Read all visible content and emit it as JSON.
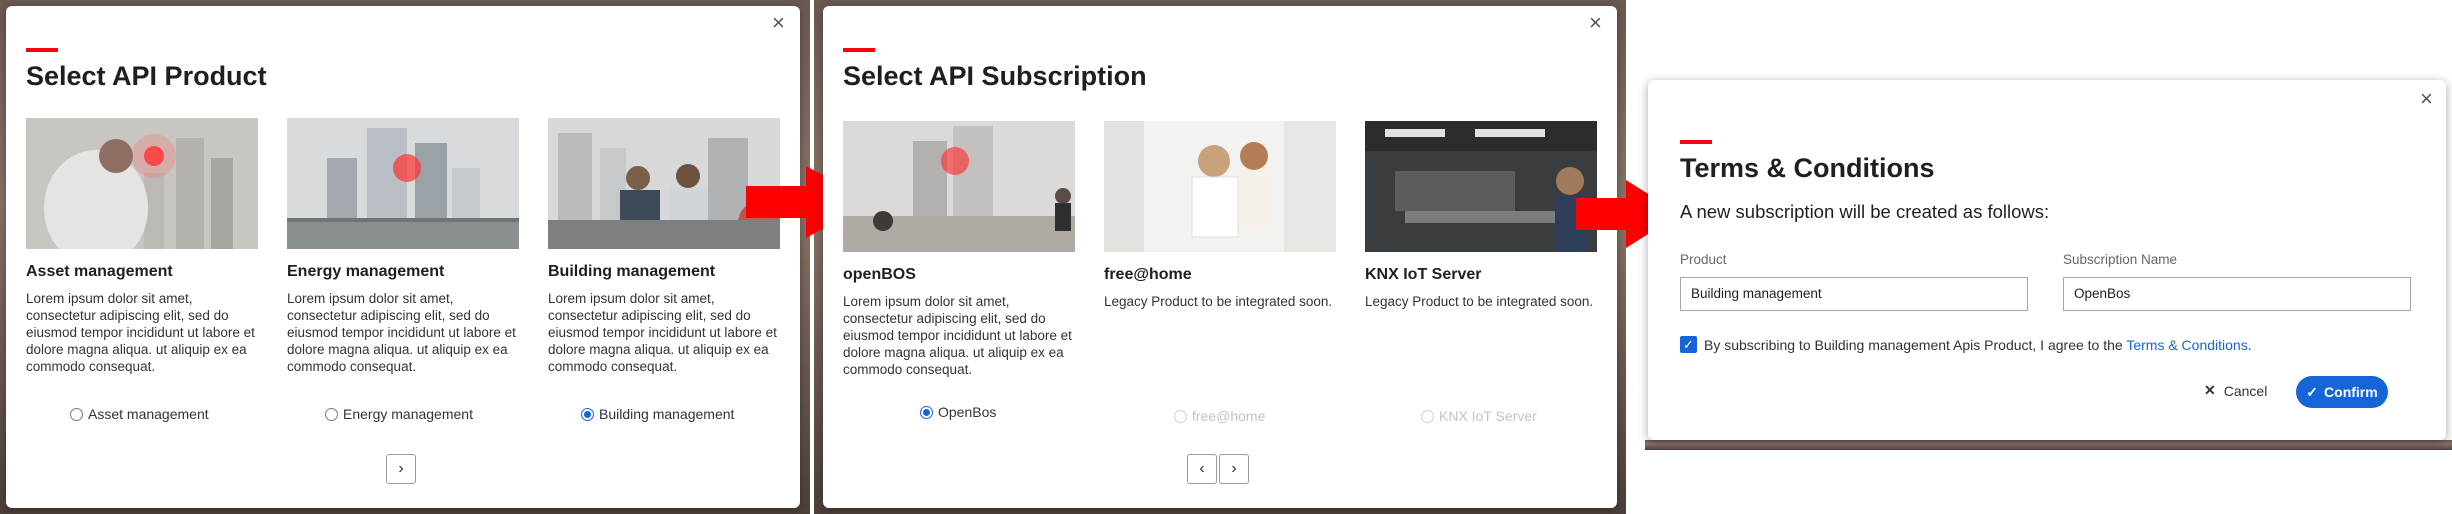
{
  "dialog1": {
    "close": "×",
    "title": "Select API Product",
    "cards": [
      {
        "name": "Asset management",
        "desc": "Lorem ipsum dolor sit amet, consectetur adipiscing elit, sed do eiusmod tempor incididunt ut labore et dolore magna aliqua. ut aliquip ex ea commodo consequat.",
        "radio": "Asset management",
        "selected": false
      },
      {
        "name": "Energy management",
        "desc": "Lorem ipsum dolor sit amet, consectetur adipiscing elit, sed do eiusmod tempor incididunt ut labore et dolore magna aliqua. ut aliquip ex ea commodo consequat.",
        "radio": "Energy management",
        "selected": false
      },
      {
        "name": "Building management",
        "desc": "Lorem ipsum dolor sit amet, consectetur adipiscing elit, sed do eiusmod tempor incididunt ut labore et dolore magna aliqua. ut aliquip ex ea commodo consequat.",
        "radio": "Building management",
        "selected": true
      }
    ],
    "next": "›"
  },
  "dialog2": {
    "close": "×",
    "title": "Select API Subscription",
    "cards": [
      {
        "name": "openBOS",
        "desc": "Lorem ipsum dolor sit amet, consectetur adipiscing elit, sed do eiusmod tempor incididunt ut labore et dolore magna aliqua. ut aliquip ex ea commodo consequat.",
        "radio": "OpenBos",
        "selected": true,
        "disabled": false
      },
      {
        "name": "free@home",
        "desc": "Legacy Product to be integrated soon.",
        "radio": "free@home",
        "selected": false,
        "disabled": true
      },
      {
        "name": "KNX IoT Server",
        "desc": "Legacy Product to be integrated soon.",
        "radio": "KNX IoT Server",
        "selected": false,
        "disabled": true
      }
    ],
    "prev": "‹",
    "next": "›"
  },
  "dialog3": {
    "close": "×",
    "title": "Terms & Conditions",
    "subtitle": "A new subscription will be created as follows:",
    "product_label": "Product",
    "product_value": "Building management",
    "subscription_label": "Subscription Name",
    "subscription_value": "OpenBos",
    "agree_text": "By subscribing to Building management Apis Product, I agree to the",
    "agree_link": "Terms & Conditions",
    "agree_end": ".",
    "cancel": "Cancel",
    "confirm": "Confirm"
  },
  "colors": {
    "accent": "#ff000f",
    "primary": "#1565d8",
    "arrow": "#ff0000"
  }
}
